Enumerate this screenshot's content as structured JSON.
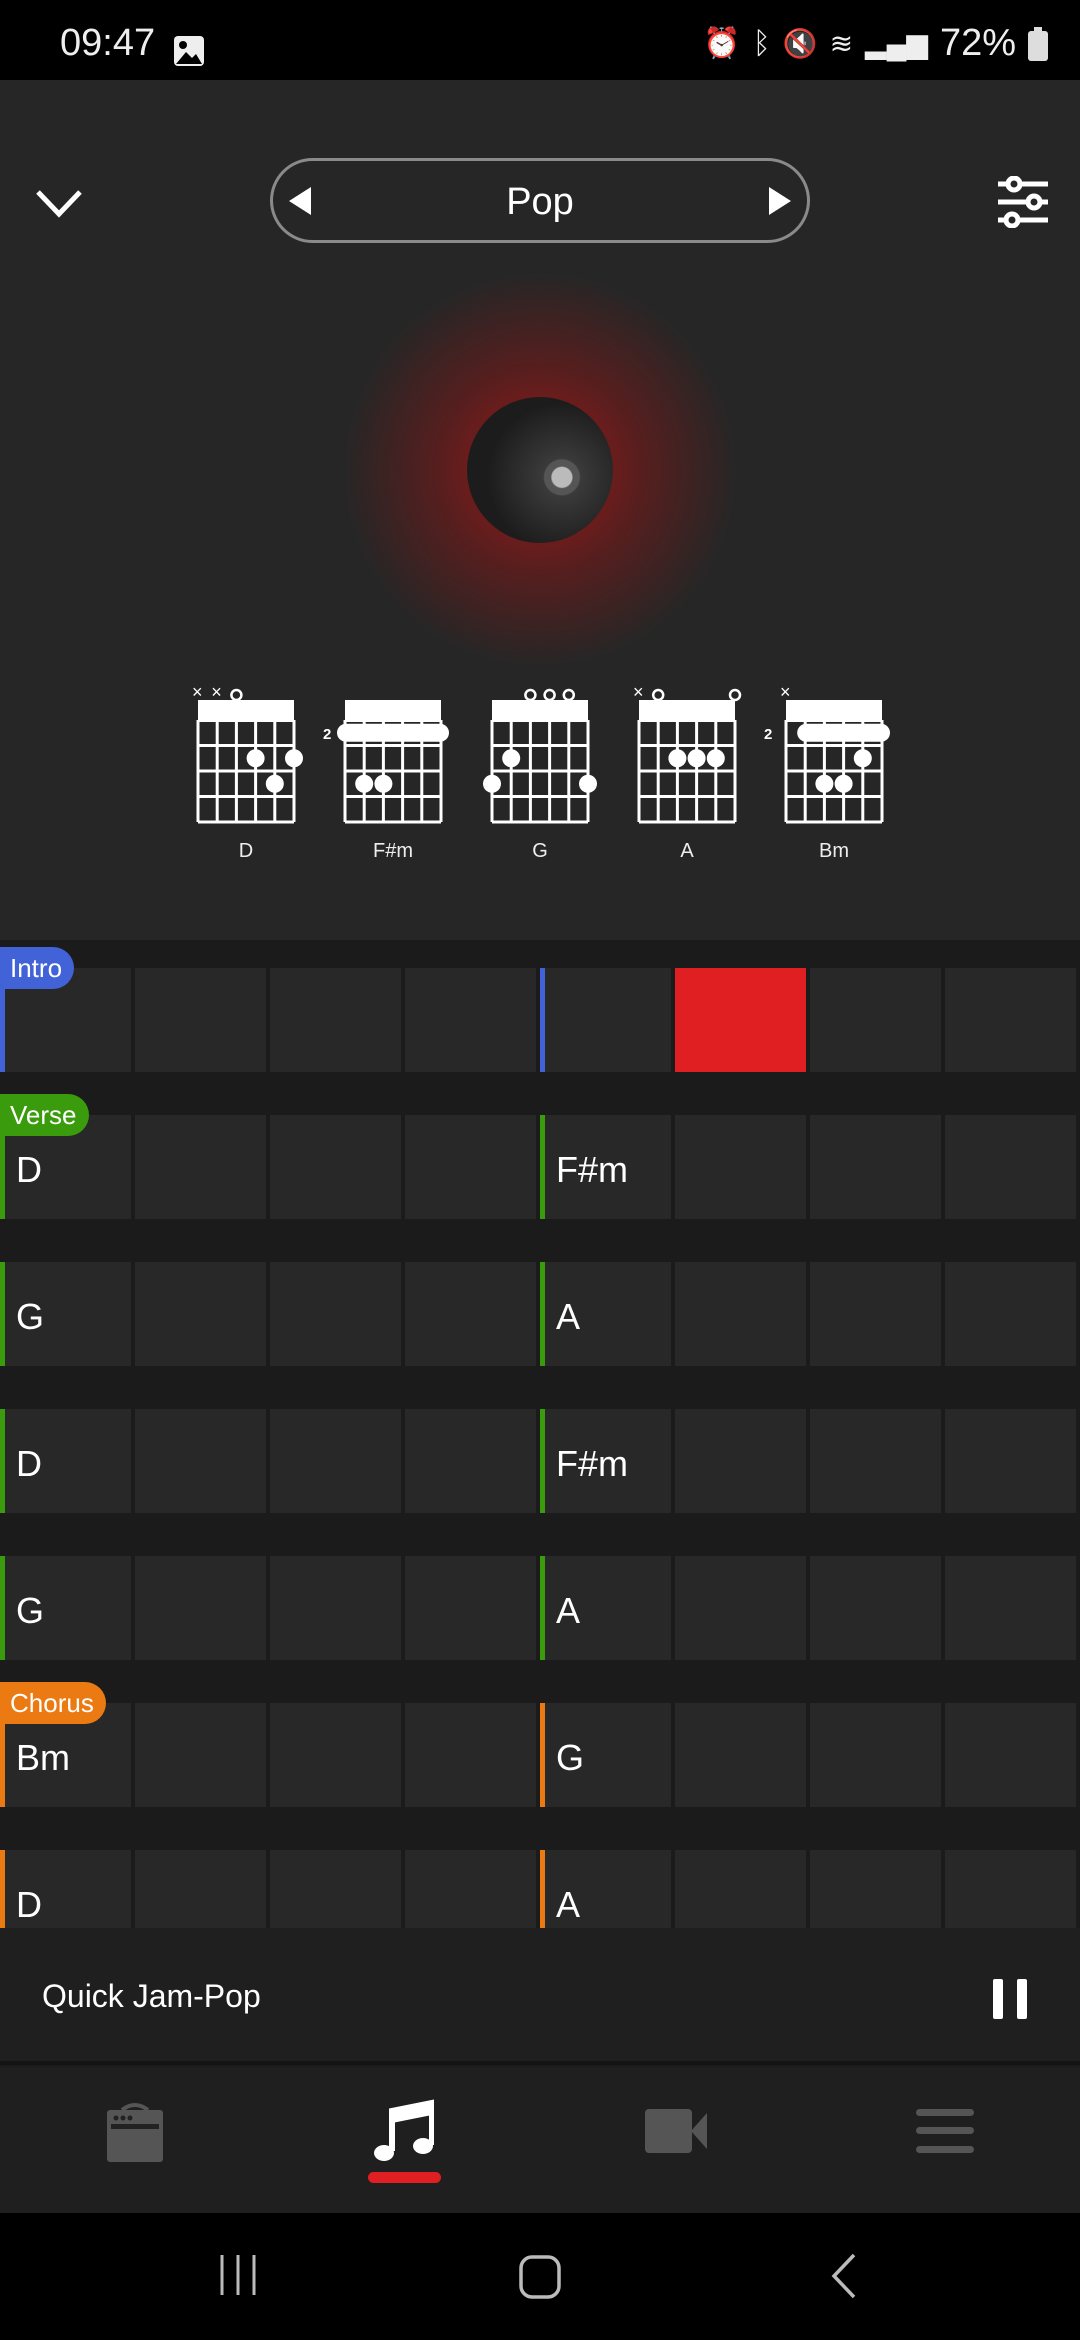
{
  "status_bar": {
    "time": "09:47",
    "battery": "72%"
  },
  "header": {
    "genre": "Pop"
  },
  "chords": [
    {
      "name": "D",
      "base_fret": "",
      "strings": [
        "x",
        "x",
        "o",
        "",
        "",
        ""
      ],
      "dots": [
        [
          3,
          2
        ],
        [
          5,
          2
        ],
        [
          4,
          3
        ]
      ],
      "barre": null
    },
    {
      "name": "F#m",
      "base_fret": "2",
      "strings": [
        "",
        "",
        "",
        "",
        "",
        ""
      ],
      "dots": [
        [
          1,
          3
        ],
        [
          2,
          3
        ]
      ],
      "barre": [
        0,
        5
      ]
    },
    {
      "name": "G",
      "base_fret": "",
      "strings": [
        "",
        "",
        "o",
        "o",
        "o",
        ""
      ],
      "dots": [
        [
          1,
          2
        ],
        [
          0,
          3
        ],
        [
          5,
          3
        ]
      ],
      "barre": null
    },
    {
      "name": "A",
      "base_fret": "",
      "strings": [
        "x",
        "o",
        "",
        "",
        "",
        "o"
      ],
      "dots": [
        [
          2,
          2
        ],
        [
          3,
          2
        ],
        [
          4,
          2
        ]
      ],
      "barre": null
    },
    {
      "name": "Bm",
      "base_fret": "2",
      "strings": [
        "x",
        "",
        "",
        "",
        "",
        ""
      ],
      "dots": [
        [
          4,
          2
        ],
        [
          2,
          3
        ],
        [
          3,
          3
        ]
      ],
      "barre": [
        1,
        5
      ]
    }
  ],
  "colors": {
    "Intro": "#4262d8",
    "Verse": "#3a9c0c",
    "Chorus": "#ec7a12",
    "active": "#e01f22"
  },
  "sections": [
    {
      "label": "Intro",
      "rows": [
        [
          "",
          "",
          "",
          "",
          "",
          "",
          "",
          ""
        ]
      ],
      "active_cell": 5
    },
    {
      "label": "Verse",
      "rows": [
        [
          "D",
          "",
          "",
          "",
          "F#m",
          "",
          "",
          ""
        ],
        [
          "G",
          "",
          "",
          "",
          "A",
          "",
          "",
          ""
        ],
        [
          "D",
          "",
          "",
          "",
          "F#m",
          "",
          "",
          ""
        ],
        [
          "G",
          "",
          "",
          "",
          "A",
          "",
          "",
          ""
        ]
      ]
    },
    {
      "label": "Chorus",
      "rows": [
        [
          "Bm",
          "",
          "",
          "",
          "G",
          "",
          "",
          ""
        ],
        [
          "D",
          "",
          "",
          "",
          "A",
          "",
          "",
          ""
        ]
      ]
    }
  ],
  "player": {
    "title": "Quick Jam-Pop"
  },
  "nav": {
    "items": [
      "amp",
      "song",
      "video",
      "menu"
    ],
    "active": 1
  }
}
